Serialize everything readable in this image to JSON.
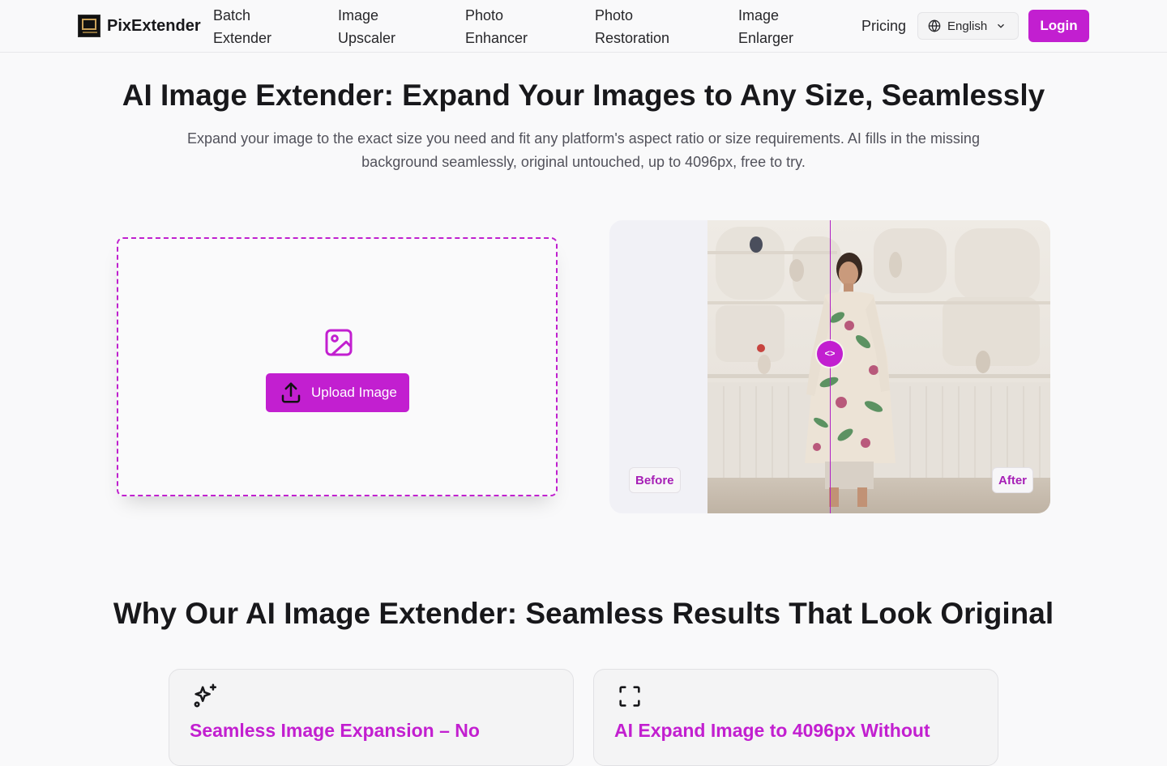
{
  "brand": {
    "name": "PixExtender"
  },
  "nav": {
    "items": [
      {
        "line1": "Batch",
        "line2": "Extender"
      },
      {
        "line1": "Image",
        "line2": "Upscaler"
      },
      {
        "line1": "Photo",
        "line2": "Enhancer"
      },
      {
        "line1": "Photo",
        "line2": "Restoration"
      },
      {
        "line1": "Image",
        "line2": "Enlarger"
      }
    ],
    "pricing": "Pricing",
    "language": "English",
    "login": "Login"
  },
  "hero": {
    "title": "AI Image Extender: Expand Your Images to Any Size, Seamlessly",
    "subtitle": "Expand your image to the exact size you need and fit any platform's aspect ratio or size requirements. AI fills in the missing background seamlessly, original untouched, up to 4096px, free to try."
  },
  "upload": {
    "button_label": "Upload Image",
    "icon": "image-icon"
  },
  "compare": {
    "before_label": "Before",
    "after_label": "After",
    "handle_glyph": "<>"
  },
  "why": {
    "title": "Why Our AI Image Extender: Seamless Results That Look Original",
    "cards": [
      {
        "icon": "sparkles-icon",
        "title": "Seamless Image Expansion – No"
      },
      {
        "icon": "expand-frame-icon",
        "title": "AI Expand Image to 4096px Without"
      }
    ]
  },
  "colors": {
    "accent": "#c21fd0",
    "text": "#18181b",
    "muted": "#52525b",
    "background": "#f9f9fa"
  }
}
